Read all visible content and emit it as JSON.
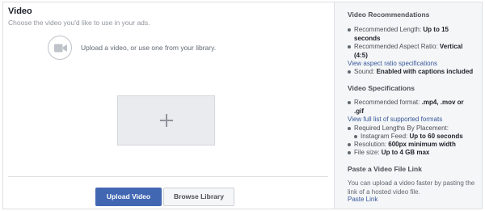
{
  "left": {
    "title": "Video",
    "subtitle": "Choose the video you'd like to use in your ads.",
    "upload_hint": "Upload a video, or use one from your library.",
    "upload_button": "Upload Video",
    "browse_button": "Browse Library"
  },
  "right": {
    "recommendations": {
      "heading": "Video Recommendations",
      "length_label": "Recommended Length:",
      "length_value": "Up to 15",
      "length_value_cont": "seconds",
      "ratio_label": "Recommended Aspect Ratio:",
      "ratio_value": "Vertical",
      "ratio_value_cont": "(4:5)",
      "ratio_link": "View aspect ratio specifications",
      "sound_label": "Sound:",
      "sound_value": "Enabled with captions included"
    },
    "specifications": {
      "heading": "Video Specifications",
      "format_label": "Recommended format:",
      "format_value": ".mp4, .mov or",
      "format_value_cont": ".gif",
      "formats_link": "View full list of supported formats",
      "lengths_label": "Required Lengths By Placement:",
      "instagram_label": "Instagram Feed:",
      "instagram_value": "Up to 60 seconds",
      "resolution_label": "Resolution:",
      "resolution_value": "600px minimum width",
      "filesize_label": "File size:",
      "filesize_value": "Up to 4 GB max"
    },
    "paste": {
      "heading": "Paste a Video File Link",
      "text_line1": "You can upload a video faster by pasting the",
      "text_line2": "link of a hosted video file.",
      "link": "Paste Link"
    }
  },
  "colors": {
    "primary_button": "#4267b2",
    "link": "#365899",
    "sidebar_bg": "#f5f6f7"
  },
  "icons": [
    "video-camera-icon",
    "plus-icon"
  ]
}
